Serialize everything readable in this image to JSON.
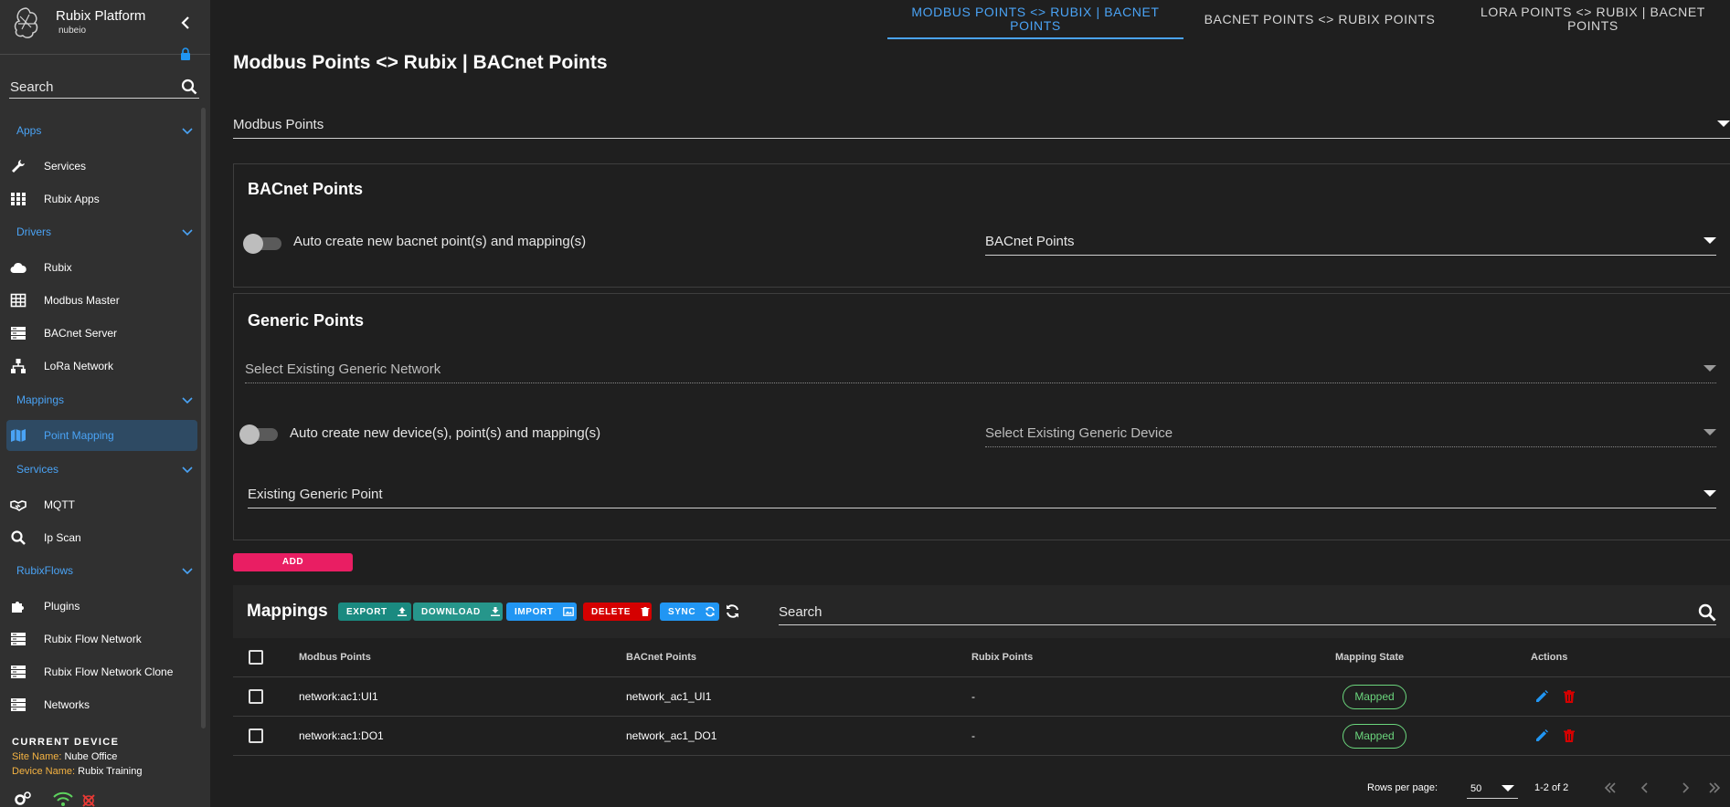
{
  "brand": {
    "title": "Rubix Platform",
    "subtitle": "nubeio"
  },
  "sidebar": {
    "search_placeholder": "Search",
    "groups": {
      "apps": "Apps",
      "drivers": "Drivers",
      "mappings": "Mappings",
      "services": "Services",
      "rubixflows": "RubixFlows"
    },
    "items": {
      "services": "Services",
      "rubix_apps": "Rubix Apps",
      "rubix": "Rubix",
      "modbus_master": "Modbus Master",
      "bacnet_server": "BACnet Server",
      "lora_network": "LoRa Network",
      "point_mapping": "Point Mapping",
      "mqtt": "MQTT",
      "ip_scan": "Ip Scan",
      "plugins": "Plugins",
      "rubix_flow_network": "Rubix Flow Network",
      "rubix_flow_network_clone": "Rubix Flow Network Clone",
      "networks": "Networks"
    },
    "current_device": {
      "title": "CURRENT DEVICE",
      "site_label": "Site Name:",
      "site_value": "Nube Office",
      "device_label": "Device Name:",
      "device_value": "Rubix Training"
    }
  },
  "tabs": {
    "modbus_bacnet": "MODBUS POINTS <> RUBIX | BACNET POINTS",
    "bacnet_rubix": "BACNET POINTS <> RUBIX POINTS",
    "lora_bacnet": "LORA POINTS <> RUBIX | BACNET POINTS"
  },
  "page": {
    "title": "Modbus Points <> Rubix | BACnet Points",
    "modbus_select": "Modbus Points"
  },
  "bacnet_card": {
    "title": "BACnet Points",
    "toggle_label": "Auto create new bacnet point(s) and mapping(s)",
    "select": "BACnet Points"
  },
  "generic_card": {
    "title": "Generic Points",
    "network_select": "Select Existing Generic Network",
    "toggle_label": "Auto create new device(s), point(s) and mapping(s)",
    "device_select": "Select Existing Generic Device",
    "point_select": "Existing Generic Point"
  },
  "add_button": "ADD",
  "mappings": {
    "title": "Mappings",
    "buttons": {
      "export": "EXPORT",
      "download": "DOWNLOAD",
      "import": "IMPORT",
      "delete": "DELETE",
      "sync": "SYNC"
    },
    "search_placeholder": "Search",
    "columns": {
      "modbus": "Modbus Points",
      "bacnet": "BACnet Points",
      "rubix": "Rubix Points",
      "state": "Mapping State",
      "actions": "Actions"
    },
    "rows": [
      {
        "modbus": "network:ac1:UI1",
        "bacnet": "network_ac1_UI1",
        "rubix": "-",
        "state": "Mapped"
      },
      {
        "modbus": "network:ac1:DO1",
        "bacnet": "network_ac1_DO1",
        "rubix": "-",
        "state": "Mapped"
      }
    ],
    "pagination": {
      "rows_per_page_label": "Rows per page:",
      "rows_per_page": "50",
      "range": "1-2 of 2"
    }
  },
  "colors": {
    "accent": "#4aa3f5",
    "add": "#e91e63",
    "export": "#1a8a80",
    "download": "#26968b",
    "import": "#2196f3",
    "delete": "#d50000",
    "sync": "#2196f3",
    "mapped": "#6bd67d",
    "site_label": "#f5b342"
  },
  "icons": [
    "logo-icon",
    "chevron-left-icon",
    "lock-icon",
    "search-icon",
    "wrench-icon",
    "grid-icon",
    "cloud-icon",
    "table-icon",
    "server-icon",
    "hierarchy-icon",
    "map-icon",
    "handshake-icon",
    "puzzle-icon",
    "gear-icon",
    "wifi-icon",
    "disconnect-icon",
    "upload-icon",
    "download-icon",
    "image-icon",
    "trash-icon",
    "sync-icon",
    "refresh-icon",
    "edit-icon",
    "first-page-icon",
    "prev-page-icon",
    "next-page-icon",
    "last-page-icon"
  ]
}
